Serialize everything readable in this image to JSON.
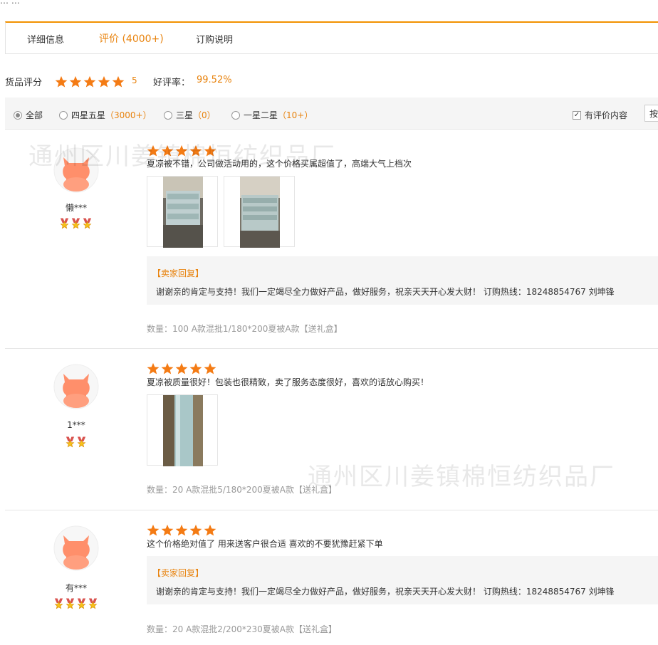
{
  "crumb": "…   …",
  "tabs": [
    {
      "label": "详细信息"
    },
    {
      "label": "评价 (4000+)"
    },
    {
      "label": "订购说明"
    }
  ],
  "score": {
    "label": "货品评分",
    "stars": 5,
    "value": "5",
    "rate_label": "好评率：",
    "rate_value": "99.52%"
  },
  "filter": {
    "all": "全部",
    "four_five": "四星五星",
    "four_five_count": "（3000+）",
    "three": "三星",
    "three_count": "（0）",
    "one_two": "一星二星",
    "one_two_count": "（10+）",
    "has_content": "有评价内容",
    "sort": "按"
  },
  "watermark": "通州区川姜镇棉恒纺织品厂",
  "reviews": [
    {
      "user": "懒***",
      "user_level": 3,
      "stars": 5,
      "text": "夏凉被不错，公司做活动用的，这个价格买属超值了，高端大气上档次",
      "photos": 2,
      "reply_title": "【卖家回复】",
      "reply_text": "谢谢亲的肯定与支持！我们一定竭尽全力做好产品，做好服务，祝亲天天开心发大财！ 订购热线：18248854767 刘坤锋",
      "meta": "数量：100   A款混批1/180*200夏被A款【送礼盒】"
    },
    {
      "user": "1***",
      "user_level": 2,
      "stars": 5,
      "text": "夏凉被质量很好！包装也很精致，卖了服务态度很好，喜欢的话放心购买！",
      "photos": 1,
      "meta": "数量：20   A款混批5/180*200夏被A款【送礼盒】"
    },
    {
      "user": "有***",
      "user_level": 4,
      "stars": 5,
      "text": "这个价格绝对值了 用来送客户很合适 喜欢的不要犹豫赶紧下单",
      "reply_title": "【卖家回复】",
      "reply_text": "谢谢亲的肯定与支持！我们一定竭尽全力做好产品，做好服务，祝亲天天开心发大财！ 订购热线：18248854767 刘坤锋",
      "meta": "数量：20   A款混批2/200*230夏被A款【送礼盒】"
    }
  ],
  "colors": {
    "accent": "#e8830e",
    "star": "#f47b14",
    "avatar": "#ff8f6b"
  }
}
